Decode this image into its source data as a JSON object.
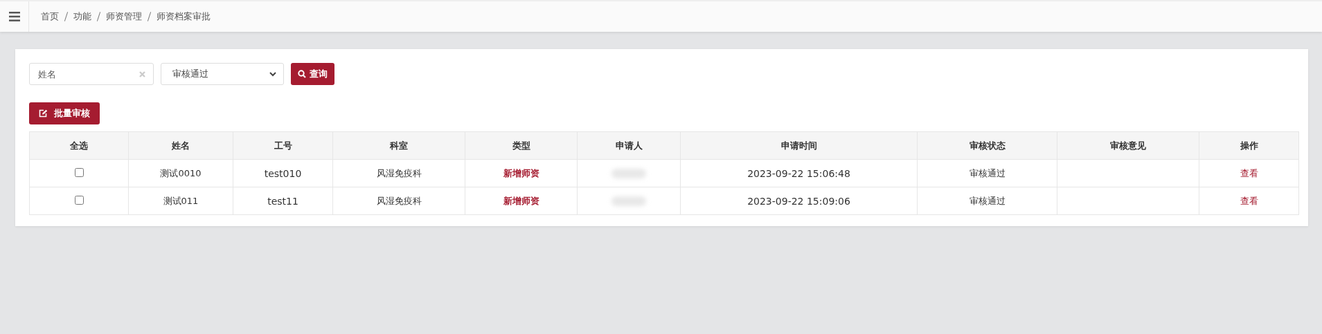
{
  "breadcrumb": [
    "首页",
    "功能",
    "师资管理",
    "师资档案审批"
  ],
  "filters": {
    "name": {
      "placeholder": "姓名"
    },
    "status": {
      "value": "审核通过"
    },
    "search_button": "查询"
  },
  "batch_button": "批量审核",
  "table": {
    "columns": [
      "全选",
      "姓名",
      "工号",
      "科室",
      "类型",
      "申请人",
      "申请时间",
      "审核状态",
      "审核意见",
      "操作"
    ],
    "rows": [
      {
        "checked": false,
        "name": "测试0010",
        "id": "test010",
        "dept": "风湿免疫科",
        "type": "新增师资",
        "time": "2023-09-22 15:06:48",
        "status": "审核通过",
        "action": "查看"
      },
      {
        "checked": false,
        "name": "测试011",
        "id": "test11",
        "dept": "风湿免疫科",
        "type": "新增师资",
        "time": "2023-09-22 15:09:06",
        "status": "审核通过",
        "action": "查看"
      }
    ]
  }
}
